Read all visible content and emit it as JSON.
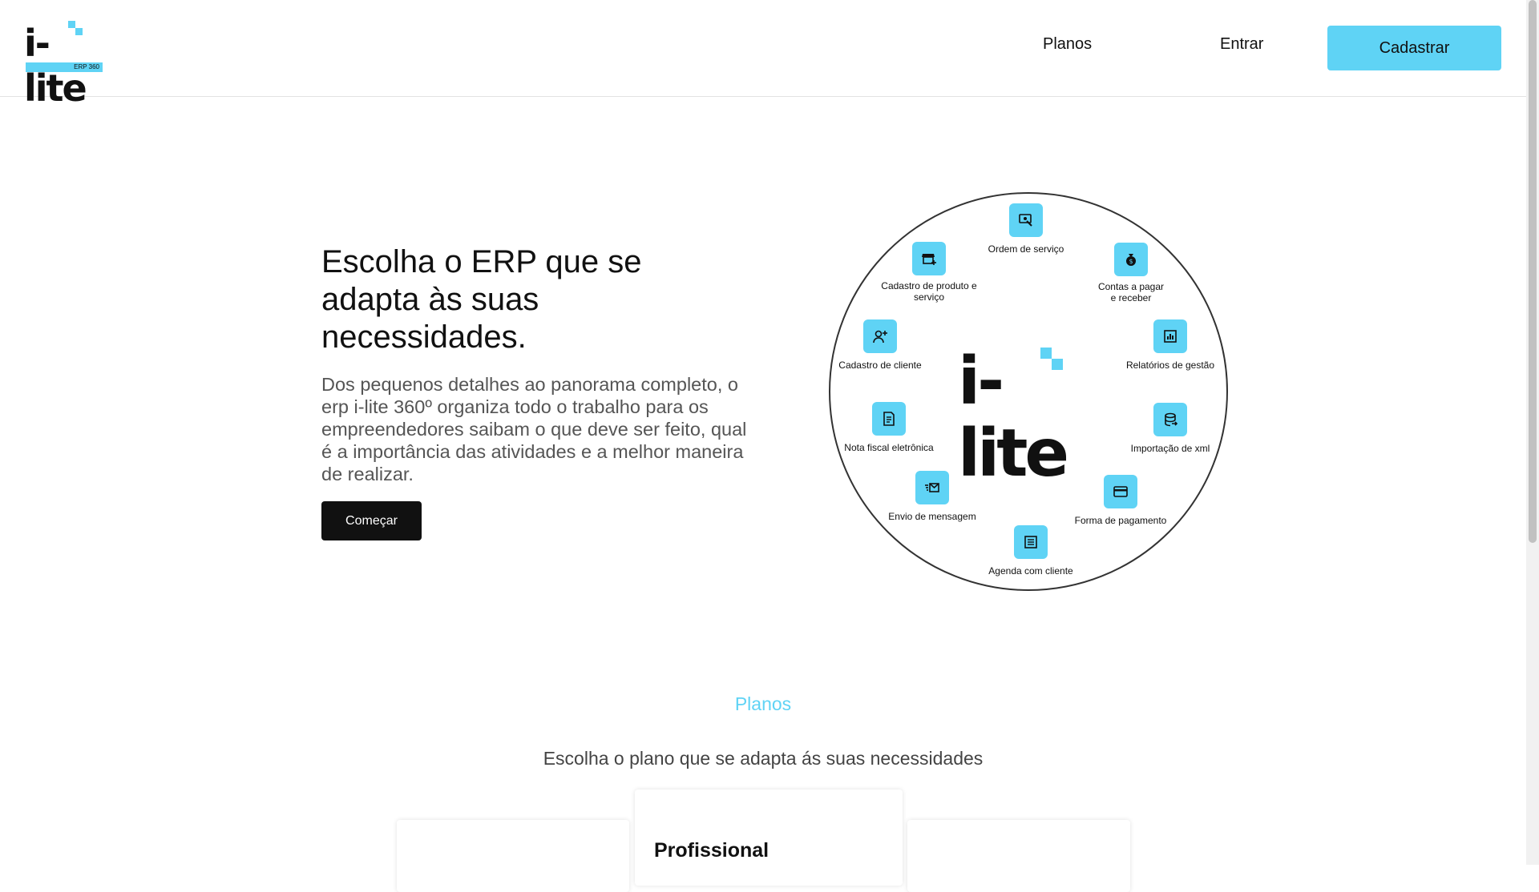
{
  "header": {
    "logo_text": "i-lite",
    "logo_sub": "ERP 360",
    "nav": {
      "planos": "Planos",
      "entrar": "Entrar"
    },
    "cadastrar_label": "Cadastrar"
  },
  "hero": {
    "title": "Escolha o ERP que se adapta às suas necessidades.",
    "description": "Dos pequenos detalhes ao panorama completo, o erp i-lite 360º organiza todo o trabalho para os empreendedores saibam o que deve ser feito, qual é a importância das atividades e a melhor maneira de realizar.",
    "cta_label": "Começar"
  },
  "diagram": {
    "center_text": "i-lite",
    "features": [
      {
        "label": "Ordem de serviço",
        "icon": "service-order-icon"
      },
      {
        "label": "Contas a pagar e receber",
        "icon": "money-bag-icon"
      },
      {
        "label": "Relatórios de gestão",
        "icon": "report-chart-icon"
      },
      {
        "label": "Importação de xml",
        "icon": "database-import-icon"
      },
      {
        "label": "Forma de pagamento",
        "icon": "credit-card-icon"
      },
      {
        "label": "Agenda com cliente",
        "icon": "calendar-list-icon"
      },
      {
        "label": "Envio de mensagem",
        "icon": "send-mail-icon"
      },
      {
        "label": "Nota fiscal eletrônica",
        "icon": "invoice-icon"
      },
      {
        "label": "Cadastro de cliente",
        "icon": "add-user-icon"
      },
      {
        "label": "Cadastro de produto e serviço",
        "icon": "store-add-icon"
      }
    ]
  },
  "plans": {
    "section_label": "Planos",
    "subtitle": "Escolha o plano que se adapta ás suas necessidades",
    "featured_name": "Profissional"
  },
  "colors": {
    "accent": "#5fd3f5",
    "dark": "#111111"
  }
}
